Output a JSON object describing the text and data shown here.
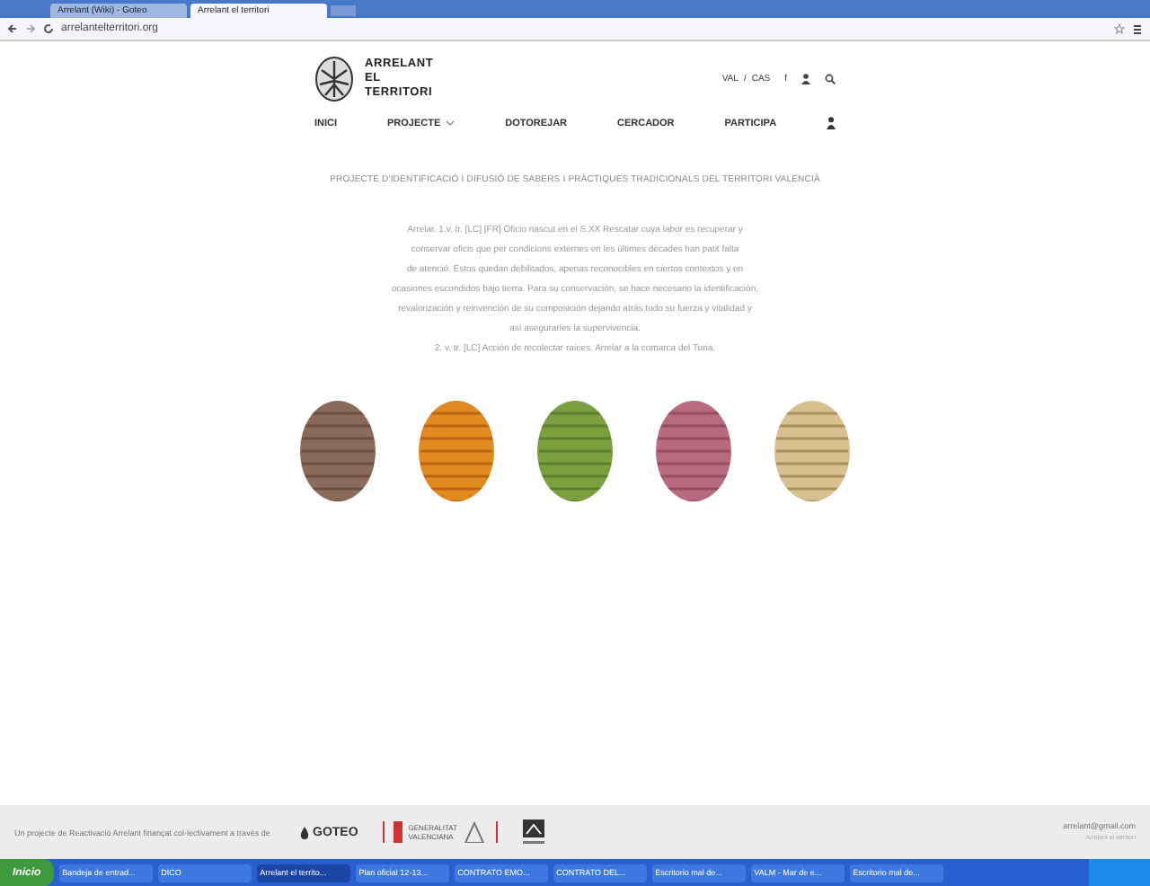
{
  "browser": {
    "tabs": [
      {
        "title": "Arrelant (Wiki) - Goteo",
        "selected": false
      },
      {
        "title": "Arrelant el territori",
        "selected": true
      }
    ],
    "address": "arrelantelterritori.org"
  },
  "site": {
    "logo_lines": [
      "ARRELANT",
      "EL",
      "TERRITORI"
    ],
    "languages": [
      "VAL",
      "/",
      "CAS"
    ],
    "facebook": "f",
    "nav": [
      {
        "label": "INICI",
        "dropdown": false
      },
      {
        "label": "PROJECTE",
        "dropdown": true
      },
      {
        "label": "DOTOREJAR",
        "dropdown": false
      },
      {
        "label": "CERCADOR",
        "dropdown": false
      },
      {
        "label": "PARTICIPA",
        "dropdown": false
      }
    ]
  },
  "intro": {
    "heading": "PROJECTE D'IDENTIFICACIÓ I DIFUSIÓ DE SABERS I PRÀCTIQUES TRADICIONALS DEL TERRITORI VALENCIÀ",
    "lines": [
      "Arrelar. 1.v. tr. [LC] [FR] Oficio nascut en el S.XX Rescatar cuya labor es recuperar y",
      "conservar oficis que per condicions externes en les últimes dècades han patit falta",
      "de atenció. Estos quedan debilitados, apenas reconocibles en ciertos contextos y en",
      "ocasiones escondidos bajo tierra. Para su conservación, se hace necesario la identificación,",
      "revalorización y reinvención de su composición dejando atrás todo su fuerza y vitalidad y",
      "así asegurarles la supervivencia.",
      "2. v. tr. [LC] Acción de recolectar raíces. Arrelar a la comarca del Turia."
    ]
  },
  "gallery": [
    {
      "kind": "bark"
    },
    {
      "kind": "honeycomb"
    },
    {
      "kind": "grass"
    },
    {
      "kind": "fabric"
    },
    {
      "kind": "cane"
    }
  ],
  "footer": {
    "credit": "Un projecte de Reactivació Arrelant finançat col·lectivament a través de",
    "goteo": "GOTEO",
    "generalitat": [
      "GENERALITAT",
      "VALENCIANA"
    ],
    "email": "arrelant@gmail.com",
    "email_note": "Arrelant el territori"
  },
  "taskbar": {
    "start": "Inicio",
    "tasks": [
      {
        "label": "Bandeja de entrad...",
        "selected": false
      },
      {
        "label": "DICO",
        "selected": false
      },
      {
        "label": "Arrelant el territo...",
        "selected": true
      },
      {
        "label": "Plan oficial 12-13...",
        "selected": false
      },
      {
        "label": "CONTRATO EMO...",
        "selected": false
      },
      {
        "label": "CONTRATO DEL...",
        "selected": false
      },
      {
        "label": "Escritorio mal de...",
        "selected": false
      },
      {
        "label": "VALM - Mar de e...",
        "selected": false
      },
      {
        "label": "Escritorio mal de...",
        "selected": false
      }
    ]
  }
}
